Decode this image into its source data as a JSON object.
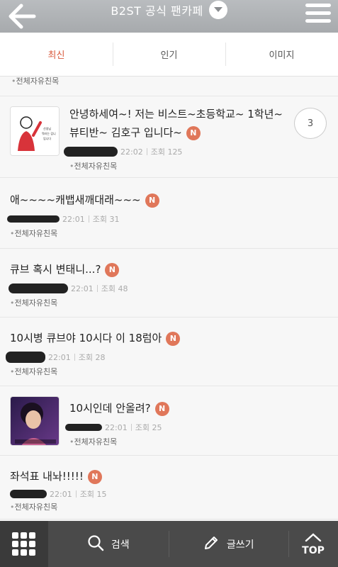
{
  "header": {
    "title": "B2ST 공식 팬카페",
    "back_icon": "back-arrow-icon",
    "dropdown_icon": "chevron-down-icon",
    "menu_icon": "hamburger-menu-icon"
  },
  "tabs": [
    {
      "label": "최신",
      "active": true
    },
    {
      "label": "인기",
      "active": false
    },
    {
      "label": "이미지",
      "active": false
    }
  ],
  "top_partial": {
    "category": "전체자유친목"
  },
  "posts": [
    {
      "title": "안녕하세여~! 저는 비스트~초등학교~ 1학년~ 뷰티반~ 김호구 입니다~",
      "badge": "N",
      "time": "22:02",
      "views": "조회 125",
      "category": "전체자유친목",
      "comments": "3",
      "thumb_text": "선생님 뭐라는 겁니 입니다"
    },
    {
      "title": "애~~~~캐뱁새깨대래~~~",
      "badge": "N",
      "time": "22:01",
      "views": "조회 31",
      "category": "전체자유친목"
    },
    {
      "title": "큐브 혹시 변태니...?",
      "badge": "N",
      "time": "22:01",
      "views": "조회 48",
      "category": "전체자유친목"
    },
    {
      "title": "10시병 큐브야 10시다 이 18럼아",
      "badge": "N",
      "time": "22:01",
      "views": "조회 28",
      "category": "전체자유친목"
    },
    {
      "title": "10시인데 안올려?",
      "badge": "N",
      "time": "22:01",
      "views": "조회 25",
      "category": "전체자유친목"
    },
    {
      "title": "좌석표 내놔!!!!!",
      "badge": "N",
      "time": "22:01",
      "views": "조회 15",
      "category": "전체자유친목"
    }
  ],
  "bottombar": {
    "grid_icon": "grid-icon",
    "search_label": "검색",
    "write_label": "글쓰기",
    "top_label": "TOP"
  },
  "colors": {
    "accent": "#d9593c",
    "badge": "#e0775a",
    "header": "#aeb1b4",
    "bottombar": "#4a4a4a"
  }
}
